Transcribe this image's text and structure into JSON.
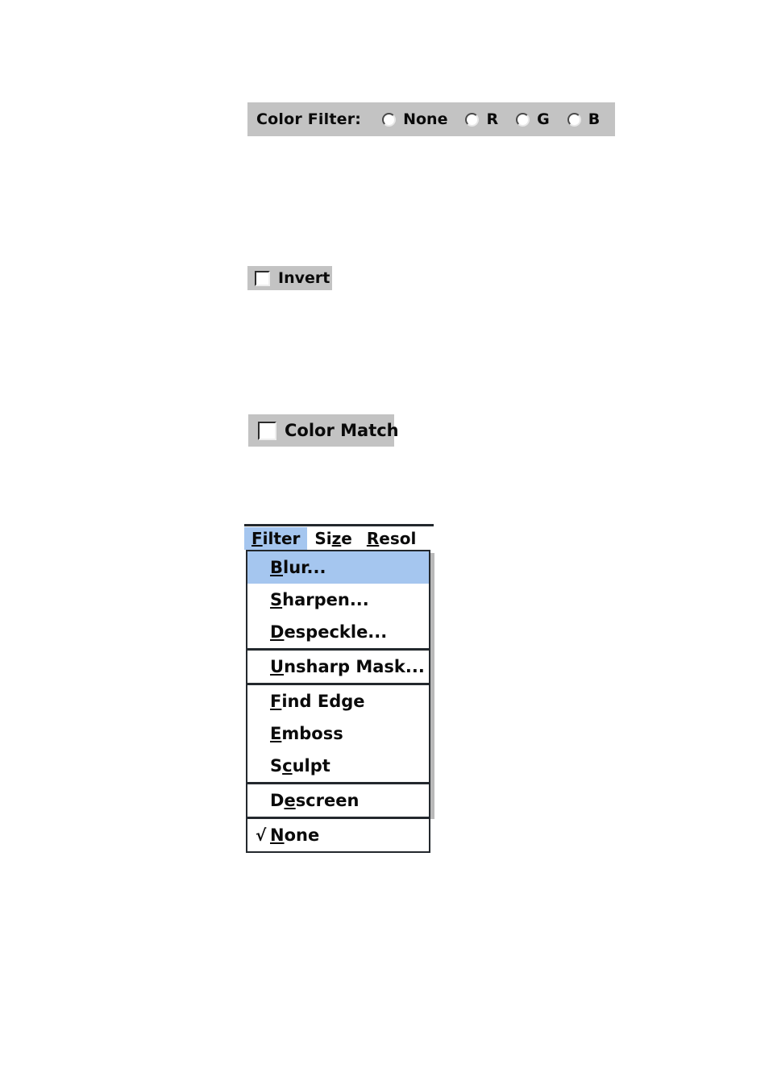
{
  "color_filter": {
    "label": "Color Filter:",
    "options": [
      {
        "label": "None",
        "selected": false
      },
      {
        "label": "R",
        "selected": false
      },
      {
        "label": "G",
        "selected": false
      },
      {
        "label": "B",
        "selected": false
      }
    ]
  },
  "invert": {
    "label": "Invert",
    "checked": false
  },
  "color_match": {
    "label": "Color Match",
    "checked": false
  },
  "menu": {
    "bar": [
      {
        "label": "Filter",
        "mnemonic": "F",
        "selected": true
      },
      {
        "label": "Size",
        "mnemonic": "z",
        "selected": false
      },
      {
        "label": "Resol",
        "mnemonic": "R",
        "selected": false
      }
    ],
    "groups": [
      {
        "items": [
          {
            "label": "Blur...",
            "mnemonic": "B",
            "selected": true,
            "checked": false
          },
          {
            "label": "Sharpen...",
            "mnemonic": "S",
            "selected": false,
            "checked": false
          },
          {
            "label": "Despeckle...",
            "mnemonic": "D",
            "selected": false,
            "checked": false
          }
        ]
      },
      {
        "items": [
          {
            "label": "Unsharp Mask...",
            "mnemonic": "U",
            "selected": false,
            "checked": false
          }
        ]
      },
      {
        "items": [
          {
            "label": "Find Edge",
            "mnemonic": "F",
            "selected": false,
            "checked": false
          },
          {
            "label": "Emboss",
            "mnemonic": "E",
            "selected": false,
            "checked": false
          },
          {
            "label": "Sculpt",
            "mnemonic": "c",
            "selected": false,
            "checked": false
          }
        ]
      },
      {
        "items": [
          {
            "label": "Descreen",
            "mnemonic": "e",
            "selected": false,
            "checked": false
          }
        ]
      },
      {
        "items": [
          {
            "label": "None",
            "mnemonic": "N",
            "selected": false,
            "checked": true
          }
        ]
      }
    ],
    "check_glyph": "√"
  },
  "colors": {
    "panel_face": "#c3c3c3",
    "highlight": "#a5c6ef",
    "border_dark": "#23282d",
    "text": "#0a0a0a",
    "page_background": "#ffffff"
  }
}
